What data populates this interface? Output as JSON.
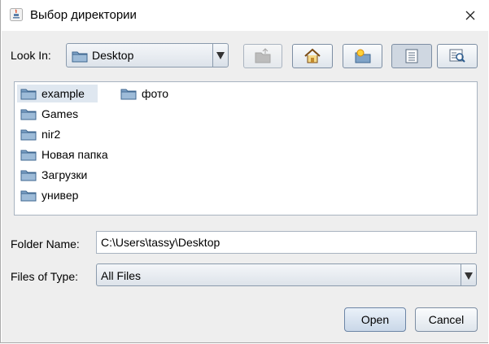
{
  "window": {
    "title": "Выбор директории"
  },
  "toolbar": {
    "look_in_label": "Look In:",
    "look_in_value": "Desktop",
    "buttons": [
      "up-folder",
      "home",
      "new-folder",
      "list-view",
      "details-view"
    ]
  },
  "files": [
    {
      "name": "example",
      "selected": true
    },
    {
      "name": "Games"
    },
    {
      "name": "nir2"
    },
    {
      "name": "Новая папка"
    },
    {
      "name": "Загрузки"
    },
    {
      "name": "универ"
    },
    {
      "name": "фото"
    }
  ],
  "folder_name": {
    "label": "Folder Name:",
    "value": "C:\\Users\\tassy\\Desktop"
  },
  "files_of_type": {
    "label": "Files of Type:",
    "value": "All Files"
  },
  "actions": {
    "open": "Open",
    "cancel": "Cancel"
  },
  "colors": {
    "background": "#eeeeee",
    "selection": "#dfe7f0",
    "border": "#7d8ea3"
  }
}
